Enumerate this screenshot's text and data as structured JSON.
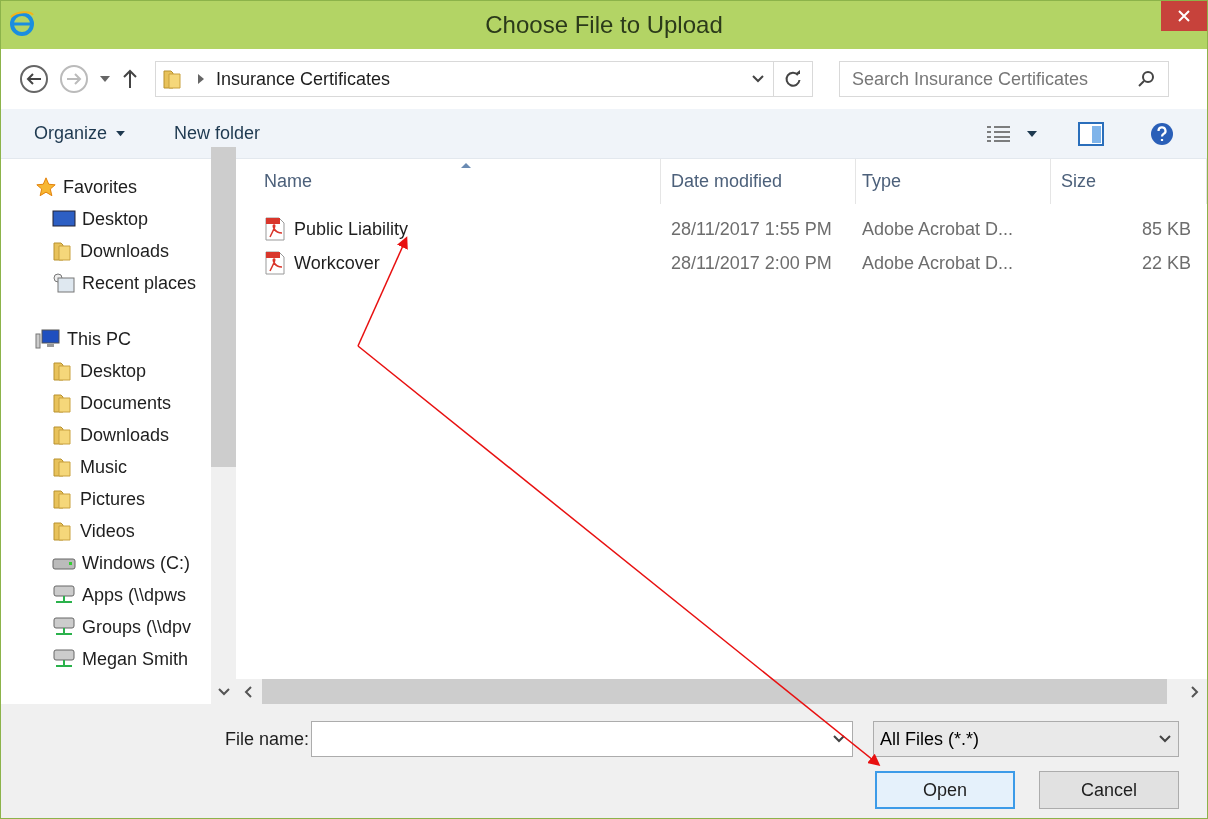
{
  "window": {
    "title": "Choose File to Upload"
  },
  "address": {
    "path": "Insurance Certificates"
  },
  "search": {
    "placeholder": "Search Insurance Certificates"
  },
  "toolbar": {
    "organize": "Organize",
    "new_folder": "New folder"
  },
  "sidebar": {
    "groups": [
      {
        "label": "Favorites",
        "kind": "favorites",
        "children": [
          {
            "label": "Desktop",
            "kind": "screen"
          },
          {
            "label": "Downloads",
            "kind": "folder"
          },
          {
            "label": "Recent places",
            "kind": "recent"
          }
        ]
      },
      {
        "label": "This PC",
        "kind": "computer",
        "children": [
          {
            "label": "Desktop",
            "kind": "folder"
          },
          {
            "label": "Documents",
            "kind": "folder"
          },
          {
            "label": "Downloads",
            "kind": "folder"
          },
          {
            "label": "Music",
            "kind": "folder"
          },
          {
            "label": "Pictures",
            "kind": "folder"
          },
          {
            "label": "Videos",
            "kind": "folder"
          },
          {
            "label": "Windows (C:)",
            "kind": "drive"
          },
          {
            "label": "Apps (\\\\dpws",
            "kind": "network"
          },
          {
            "label": "Groups (\\\\dpv",
            "kind": "network"
          },
          {
            "label": "Megan Smith",
            "kind": "network"
          }
        ]
      }
    ]
  },
  "table": {
    "columns": [
      "Name",
      "Date modified",
      "Type",
      "Size"
    ],
    "rows": [
      {
        "name": "Public Liability",
        "date": "28/11/2017 1:55 PM",
        "type": "Adobe Acrobat D...",
        "size": "85 KB"
      },
      {
        "name": "Workcover",
        "date": "28/11/2017 2:00 PM",
        "type": "Adobe Acrobat D...",
        "size": "22 KB"
      }
    ]
  },
  "file_name": {
    "label": "File name:"
  },
  "file_type": {
    "value": "All Files (*.*)"
  },
  "buttons": [
    {
      "label": "Open",
      "default": true
    },
    {
      "label": "Cancel",
      "default": false
    }
  ]
}
